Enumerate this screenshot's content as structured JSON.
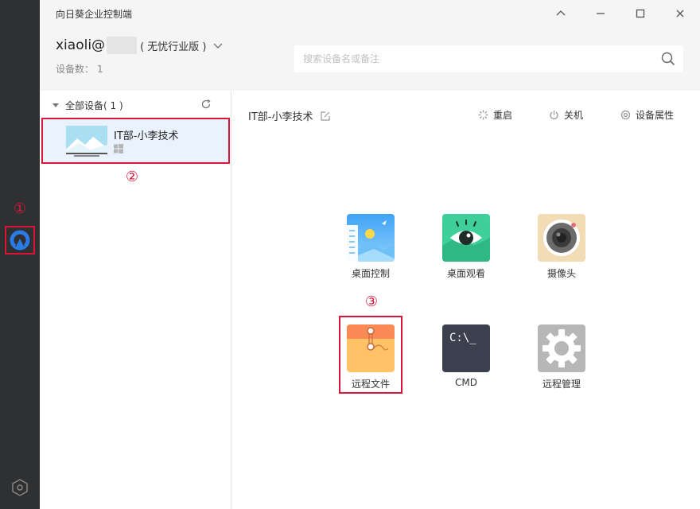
{
  "app": {
    "title": "向日葵企业控制端"
  },
  "account": {
    "user": "xiaoli@",
    "edition": "( 无忧行业版 )"
  },
  "device_count": {
    "label": "设备数：",
    "value": "1"
  },
  "search": {
    "placeholder": "搜索设备名或备注"
  },
  "sidebar": {
    "group_label": "全部设备( 1 )",
    "devices": [
      {
        "name": "IT部-小李技术",
        "os": "windows"
      }
    ]
  },
  "main": {
    "device_title": "IT部-小李技术",
    "actions": {
      "restart": "重启",
      "shutdown": "关机",
      "properties": "设备属性"
    },
    "tiles": [
      {
        "label": "桌面控制",
        "icon": "desktop-control-icon"
      },
      {
        "label": "桌面观看",
        "icon": "desktop-view-icon"
      },
      {
        "label": "摄像头",
        "icon": "camera-icon"
      },
      {
        "label": "远程文件",
        "icon": "remote-file-icon"
      },
      {
        "label": "CMD",
        "icon": "cmd-icon"
      },
      {
        "label": "远程管理",
        "icon": "remote-manage-icon"
      }
    ],
    "cmd_prompt": "C:\\_"
  },
  "annotations": {
    "one": "①",
    "two": "②",
    "three": "③"
  },
  "colors": {
    "highlight": "#d9163a",
    "leftbar": "#2f3032",
    "selected_bg": "#eaf2fd",
    "brand": "#2b7be6"
  }
}
